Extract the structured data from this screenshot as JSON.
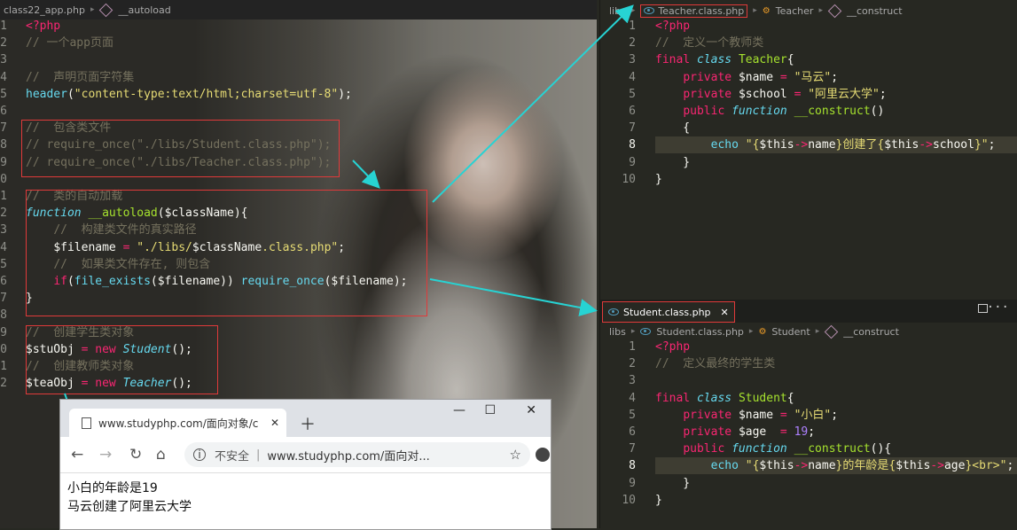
{
  "left_editor": {
    "breadcrumb": [
      "class22_app.php",
      "__autoload"
    ],
    "lines": [
      {
        "n": "1",
        "html": "<span class='kw'>&lt;?php</span>"
      },
      {
        "n": "2",
        "html": "<span class='cm'>// 一个app页面</span>"
      },
      {
        "n": "3",
        "html": ""
      },
      {
        "n": "4",
        "html": "<span class='cm'>//  声明页面字符集</span>"
      },
      {
        "n": "5",
        "html": "<span class='fn'>header</span>(<span class='st'>\"content-type:text/html;charset=utf-8\"</span>);"
      },
      {
        "n": "6",
        "html": ""
      },
      {
        "n": "7",
        "html": "<span class='cm'>//  包含类文件</span>"
      },
      {
        "n": "8",
        "html": "<span class='cm'>// require_once(\"./libs/Student.class.php\");</span>"
      },
      {
        "n": "9",
        "html": "<span class='cm'>// require_once(\"./libs/Teacher.class.php\");</span>"
      },
      {
        "n": "0",
        "html": ""
      },
      {
        "n": "1",
        "html": "<span class='cm'>//  类的自动加载</span>"
      },
      {
        "n": "2",
        "html": "<span class='it'>function</span> <span class='cl'>__autoload</span>(<span class='vr'>$className</span>){"
      },
      {
        "n": "3",
        "html": "    <span class='cm'>//  构建类文件的真实路径</span>"
      },
      {
        "n": "4",
        "html": "    <span class='vr'>$filename</span> <span class='kw'>=</span> <span class='st'>\"./libs/</span><span class='vr'>$className</span><span class='st'>.class.php\"</span>;"
      },
      {
        "n": "5",
        "html": "    <span class='cm'>//  如果类文件存在, 则包含</span>"
      },
      {
        "n": "6",
        "html": "    <span class='kw'>if</span>(<span class='fn'>file_exists</span>(<span class='vr'>$filename</span>)) <span class='fn'>require_once</span>(<span class='vr'>$filename</span>);"
      },
      {
        "n": "7",
        "html": "}"
      },
      {
        "n": "8",
        "html": ""
      },
      {
        "n": "9",
        "html": "<span class='cm'>//  创建学生类对象</span>"
      },
      {
        "n": "0",
        "html": "<span class='vr'>$stuObj</span> <span class='kw'>=</span> <span class='kw'>new</span> <span class='it'>Student</span>();"
      },
      {
        "n": "1",
        "html": "<span class='cm'>//  创建教师类对象</span>"
      },
      {
        "n": "2",
        "html": "<span class='vr'>$teaObj</span> <span class='kw'>=</span> <span class='kw'>new</span> <span class='it'>Teacher</span>();"
      }
    ]
  },
  "teacher_editor": {
    "breadcrumb": [
      "libs",
      "Teacher.class.php",
      "Teacher",
      "__construct"
    ],
    "lines": [
      {
        "n": "1",
        "html": "<span class='kw'>&lt;?php</span>"
      },
      {
        "n": "2",
        "html": "<span class='cm'>//  定义一个教师类</span>"
      },
      {
        "n": "3",
        "html": "<span class='kw'>final</span> <span class='it'>class</span> <span class='cl'>Teacher</span>{"
      },
      {
        "n": "4",
        "html": "    <span class='kw'>private</span> <span class='vr'>$name</span> <span class='kw'>=</span> <span class='st'>\"马云\"</span>;"
      },
      {
        "n": "5",
        "html": "    <span class='kw'>private</span> <span class='vr'>$school</span> <span class='kw'>=</span> <span class='st'>\"阿里云大学\"</span>;"
      },
      {
        "n": "6",
        "html": "    <span class='kw'>public</span> <span class='it'>function</span> <span class='cl'>__construct</span>()"
      },
      {
        "n": "7",
        "html": "    {"
      },
      {
        "n": "8",
        "html": "        <span class='fn'>echo</span> <span class='st'>\"{</span><span class='vr'>$this</span><span class='kw'>-&gt;</span><span class='vr'>name</span><span class='st'>}创建了{</span><span class='vr'>$this</span><span class='kw'>-&gt;</span><span class='vr'>school</span><span class='st'>}\"</span>;"
      },
      {
        "n": "9",
        "html": "    }"
      },
      {
        "n": "10",
        "html": "}"
      }
    ]
  },
  "student_editor": {
    "tab": "Student.class.php",
    "breadcrumb": [
      "libs",
      "Student.class.php",
      "Student",
      "__construct"
    ],
    "lines": [
      {
        "n": "1",
        "html": "<span class='kw'>&lt;?php</span>"
      },
      {
        "n": "2",
        "html": "<span class='cm'>//  定义最终的学生类</span>"
      },
      {
        "n": "3",
        "html": ""
      },
      {
        "n": "4",
        "html": "<span class='kw'>final</span> <span class='it'>class</span> <span class='cl'>Student</span>{"
      },
      {
        "n": "5",
        "html": "    <span class='kw'>private</span> <span class='vr'>$name</span> <span class='kw'>=</span> <span class='st'>\"小白\"</span>;"
      },
      {
        "n": "6",
        "html": "    <span class='kw'>private</span> <span class='vr'>$age</span>  <span class='kw'>=</span> <span style='color:#ae81ff'>19</span>;"
      },
      {
        "n": "7",
        "html": "    <span class='kw'>public</span> <span class='it'>function</span> <span class='cl'>__construct</span>(){"
      },
      {
        "n": "8",
        "html": "        <span class='fn'>echo</span> <span class='st'>\"{</span><span class='vr'>$this</span><span class='kw'>-&gt;</span><span class='vr'>name</span><span class='st'>}的年龄是{</span><span class='vr'>$this</span><span class='kw'>-&gt;</span><span class='vr'>age</span><span class='st'>}&lt;br&gt;\"</span>;"
      },
      {
        "n": "9",
        "html": "    }"
      },
      {
        "n": "10",
        "html": "}"
      }
    ]
  },
  "browser": {
    "tab_title": "www.studyphp.com/面向对象/c",
    "security": "不安全",
    "url": "www.studyphp.com/面向对...",
    "output_line1": "小白的年龄是19",
    "output_line2": "马云创建了阿里云大学"
  },
  "colors": {
    "accent_arrow": "#27d3d3",
    "box": "#e03a3a"
  }
}
